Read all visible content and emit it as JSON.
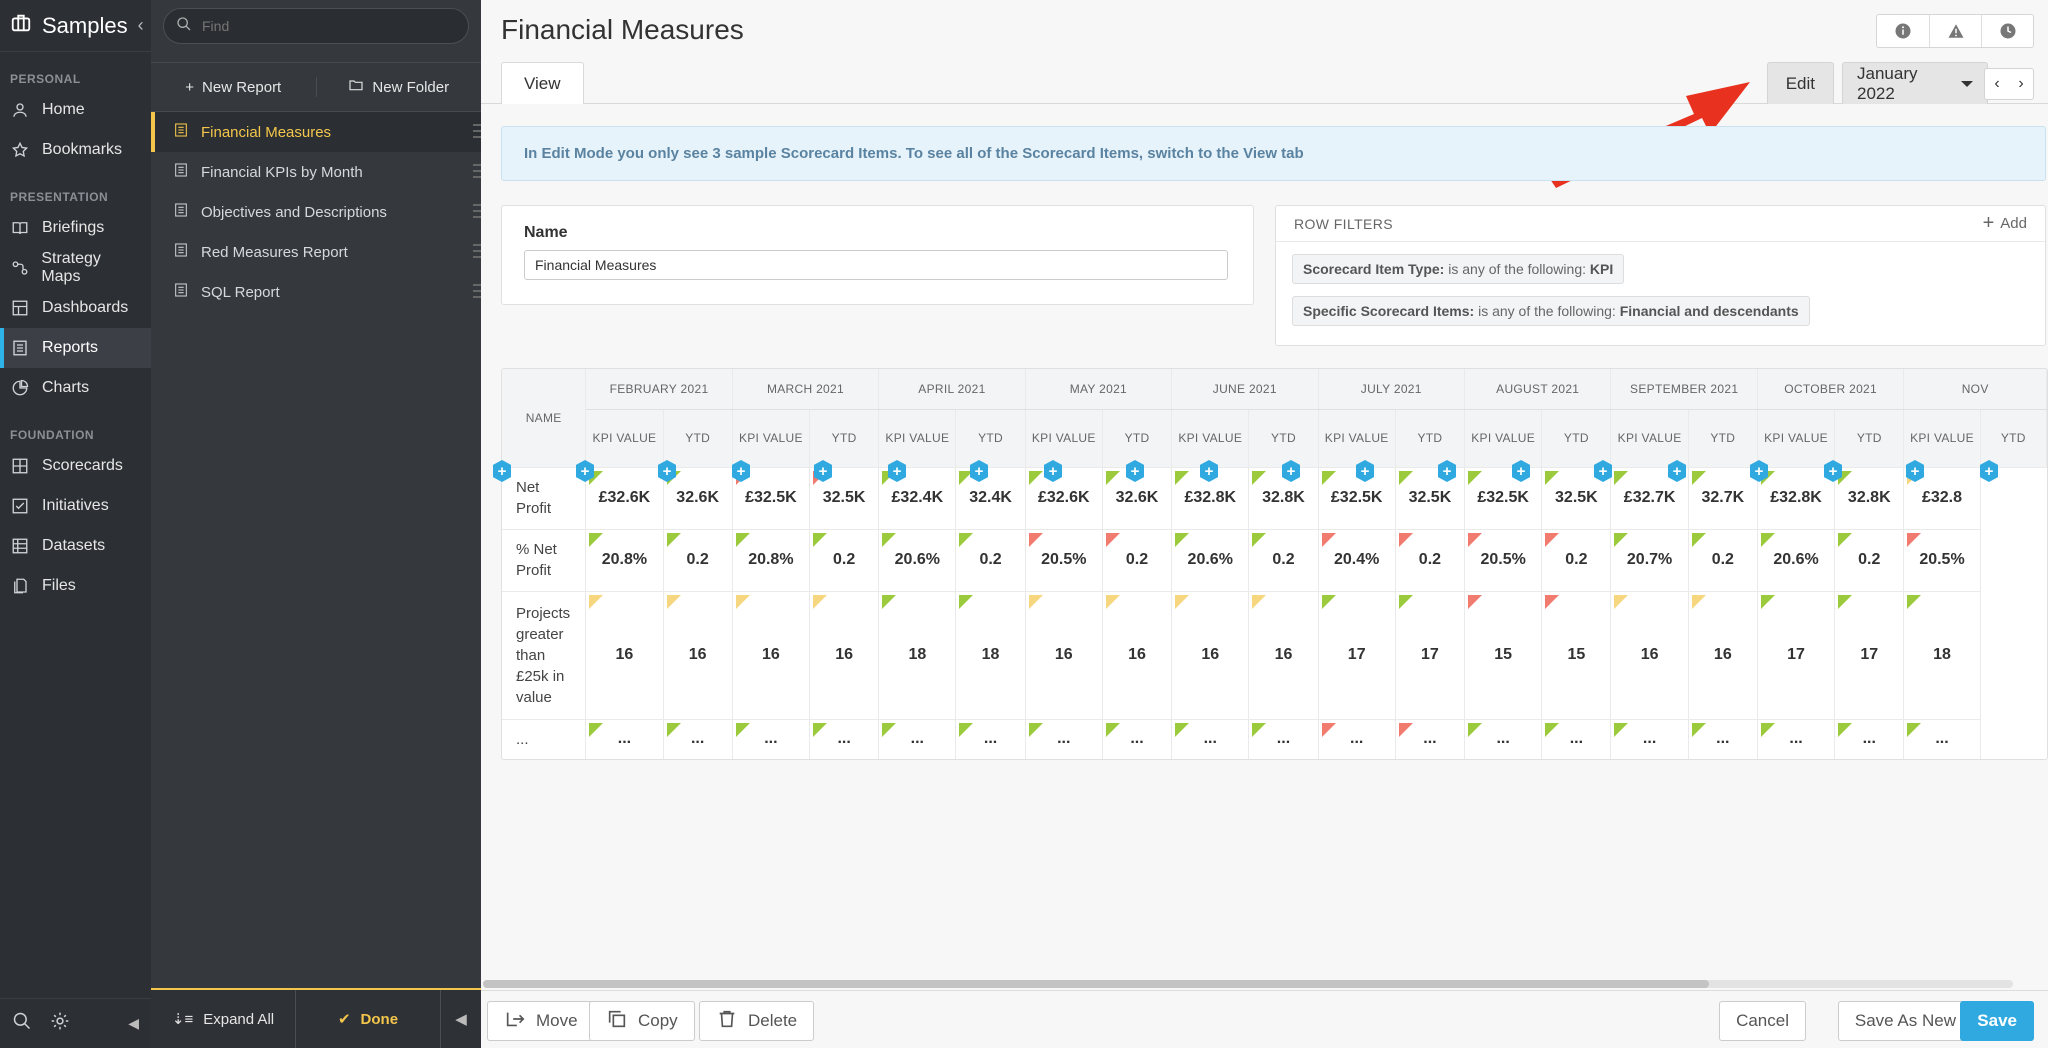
{
  "app": {
    "title": "Samples"
  },
  "sidebar": {
    "sections": [
      {
        "label": "PERSONAL",
        "items": [
          {
            "label": "Home",
            "icon": "person-icon"
          },
          {
            "label": "Bookmarks",
            "icon": "star-icon"
          }
        ]
      },
      {
        "label": "PRESENTATION",
        "items": [
          {
            "label": "Briefings",
            "icon": "book-icon"
          },
          {
            "label": "Strategy Maps",
            "icon": "strategy-map-icon"
          },
          {
            "label": "Dashboards",
            "icon": "dashboard-icon"
          },
          {
            "label": "Reports",
            "icon": "report-icon",
            "active": true
          },
          {
            "label": "Charts",
            "icon": "pie-chart-icon"
          }
        ]
      },
      {
        "label": "FOUNDATION",
        "items": [
          {
            "label": "Scorecards",
            "icon": "scorecard-icon"
          },
          {
            "label": "Initiatives",
            "icon": "checkbox-icon"
          },
          {
            "label": "Datasets",
            "icon": "dataset-icon"
          },
          {
            "label": "Files",
            "icon": "files-icon"
          }
        ]
      }
    ]
  },
  "panel": {
    "find_placeholder": "Find",
    "new_report": "New Report",
    "new_folder": "New Folder",
    "reports": [
      "Financial Measures",
      "Financial KPIs by Month",
      "Objectives and Descriptions",
      "Red Measures Report",
      "SQL Report"
    ],
    "expand_all": "Expand All",
    "done": "Done"
  },
  "main": {
    "title": "Financial Measures",
    "tab_view": "View",
    "edit": "Edit",
    "period": "January 2022",
    "banner": "In Edit Mode you only see 3 sample Scorecard Items. To see all of the Scorecard Items, switch to the View tab",
    "name_label": "Name",
    "name_value": "Financial Measures",
    "row_filters": "ROW FILTERS",
    "add": "Add",
    "filter1": {
      "key": "Scorecard Item Type:",
      "text": " is any of the following: ",
      "value": "KPI"
    },
    "filter2": {
      "key": "Specific Scorecard Items:",
      "text": " is any of the following: ",
      "value": "Financial and descendants"
    }
  },
  "table": {
    "name_header": "NAME",
    "kpi_header": "KPI VALUE",
    "ytd_header": "YTD",
    "months": [
      "FEBRUARY 2021",
      "MARCH 2021",
      "APRIL 2021",
      "MAY 2021",
      "JUNE 2021",
      "JULY 2021",
      "AUGUST 2021",
      "SEPTEMBER 2021",
      "OCTOBER 2021",
      "NOV"
    ],
    "rows": [
      {
        "name": "Net Profit",
        "cells": [
          "£32.6K",
          "32.6K",
          "£32.5K",
          "32.5K",
          "£32.4K",
          "32.4K",
          "£32.6K",
          "32.6K",
          "£32.8K",
          "32.8K",
          "£32.5K",
          "32.5K",
          "£32.5K",
          "32.5K",
          "£32.7K",
          "32.7K",
          "£32.8K",
          "32.8K",
          "£32.8"
        ],
        "flags": [
          "g",
          "g",
          "r",
          "r",
          "g",
          "g",
          "g",
          "g",
          "g",
          "g",
          "g",
          "g",
          "g",
          "g",
          "g",
          "g",
          "g",
          "g",
          "y"
        ]
      },
      {
        "name": "% Net Profit",
        "cells": [
          "20.8%",
          "0.2",
          "20.8%",
          "0.2",
          "20.6%",
          "0.2",
          "20.5%",
          "0.2",
          "20.6%",
          "0.2",
          "20.4%",
          "0.2",
          "20.5%",
          "0.2",
          "20.7%",
          "0.2",
          "20.6%",
          "0.2",
          "20.5%"
        ],
        "flags": [
          "g",
          "g",
          "g",
          "g",
          "g",
          "g",
          "r",
          "r",
          "g",
          "g",
          "r",
          "r",
          "r",
          "r",
          "g",
          "g",
          "g",
          "g",
          "r"
        ]
      },
      {
        "name": "Projects greater than £25k in value",
        "cells": [
          "16",
          "16",
          "16",
          "16",
          "18",
          "18",
          "16",
          "16",
          "16",
          "16",
          "17",
          "17",
          "15",
          "15",
          "16",
          "16",
          "17",
          "17",
          "18"
        ],
        "flags": [
          "y",
          "y",
          "y",
          "y",
          "g",
          "g",
          "y",
          "y",
          "y",
          "y",
          "g",
          "g",
          "r",
          "r",
          "y",
          "y",
          "g",
          "g",
          "g"
        ]
      },
      {
        "name": "...",
        "cells": [
          "...",
          "...",
          "...",
          "...",
          "...",
          "...",
          "...",
          "...",
          "...",
          "...",
          "...",
          "...",
          "...",
          "...",
          "...",
          "...",
          "...",
          "...",
          "..."
        ],
        "flags": [
          "g",
          "g",
          "g",
          "g",
          "g",
          "g",
          "g",
          "g",
          "g",
          "g",
          "r",
          "r",
          "g",
          "g",
          "g",
          "g",
          "g",
          "g",
          "g"
        ]
      }
    ]
  },
  "footer": {
    "move": "Move",
    "copy": "Copy",
    "delete": "Delete",
    "cancel": "Cancel",
    "save_as_new": "Save As New",
    "save": "Save"
  },
  "colors": {
    "accent": "#2fa9e0",
    "active_report": "#f4c64b",
    "flag_green": "#9bcb3c",
    "flag_red": "#f07b6e",
    "flag_yellow": "#f6d67e",
    "annotation_arrow": "#e8321f"
  }
}
